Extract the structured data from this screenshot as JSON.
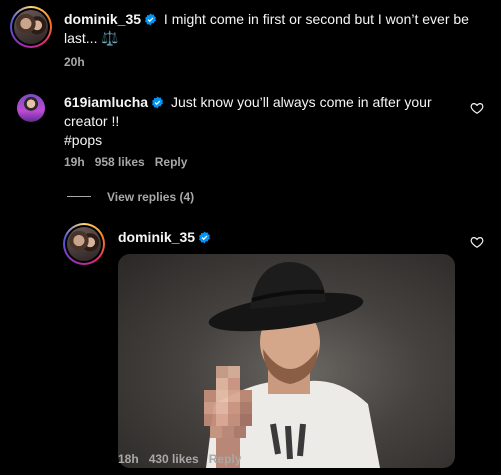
{
  "post": {
    "username": "dominik_35",
    "caption": "I might come in first or second but I won’t ever be last... ⚖️",
    "time": "20h"
  },
  "comment": {
    "username": "619iamlucha",
    "text_line1": "Just know you’ll always come in after your",
    "text_line2": "creator !!",
    "hashtag": "#pops",
    "time": "19h",
    "likes": "958 likes",
    "reply_label": "Reply",
    "view_replies": "View replies (4)"
  },
  "reply": {
    "username": "dominik_35",
    "time": "18h",
    "likes": "430 likes",
    "reply_label": "Reply"
  },
  "colors": {
    "background": "#000000",
    "verified": "#0095f6",
    "muted": "#a8a8a8"
  }
}
